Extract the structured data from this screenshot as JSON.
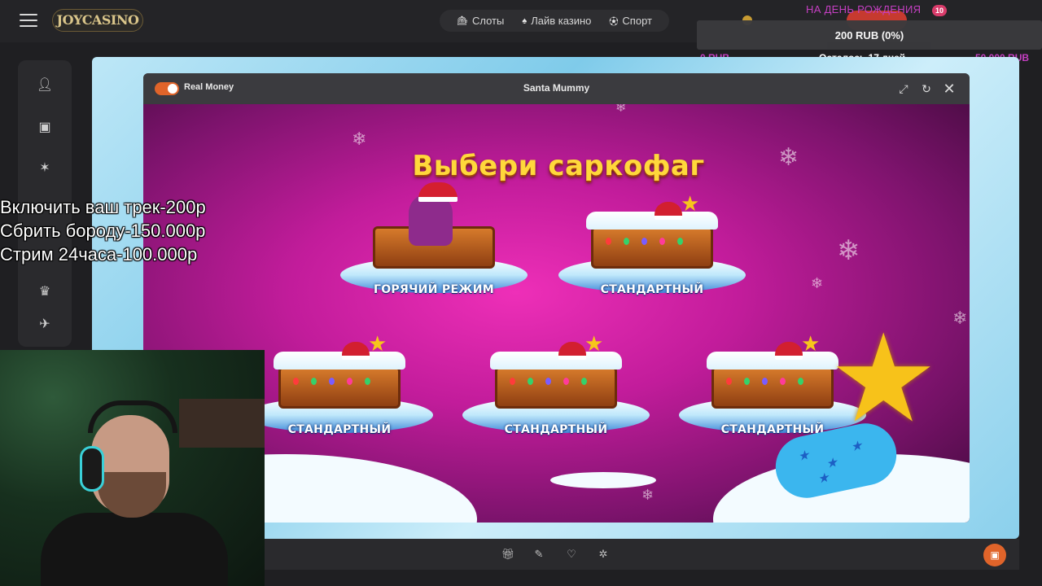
{
  "header": {
    "logo_text": "JOYCASINO",
    "nav": [
      {
        "label": "Слоты",
        "icon": "slots-icon"
      },
      {
        "label": "Лайв казино",
        "icon": "live-casino-icon"
      },
      {
        "label": "Спорт",
        "icon": "soccer-ball-icon"
      }
    ],
    "birthday_label": "НА ДЕНЬ РОЖДЕНИЯ",
    "birthday_count": "10"
  },
  "donation_goal": {
    "amount": "200 RUB (0%)",
    "min": "0 RUB",
    "remaining": "Осталось 17 дней",
    "max": "50 000 RUB"
  },
  "game": {
    "mode_label": "Real Money",
    "title": "Santa Mummy",
    "headline": "Выбери саркофаг",
    "chests": [
      {
        "label": "ГОРЯЧИЙ РЕЖИМ"
      },
      {
        "label": "СТАНДАРТНЫЙ"
      },
      {
        "label": "СТАНДАРТНЫЙ"
      },
      {
        "label": "СТАНДАРТНЫЙ"
      },
      {
        "label": "СТАНДАРТНЫЙ"
      }
    ]
  },
  "overlay_lines": [
    "Включить ваш трек-200р",
    "Сбрить бороду-150.000р",
    "Стрим 24часа-100.000р"
  ],
  "colors": {
    "accent": "#e0642a",
    "magenta": "#c21c9b",
    "gold": "#ffd83b"
  }
}
